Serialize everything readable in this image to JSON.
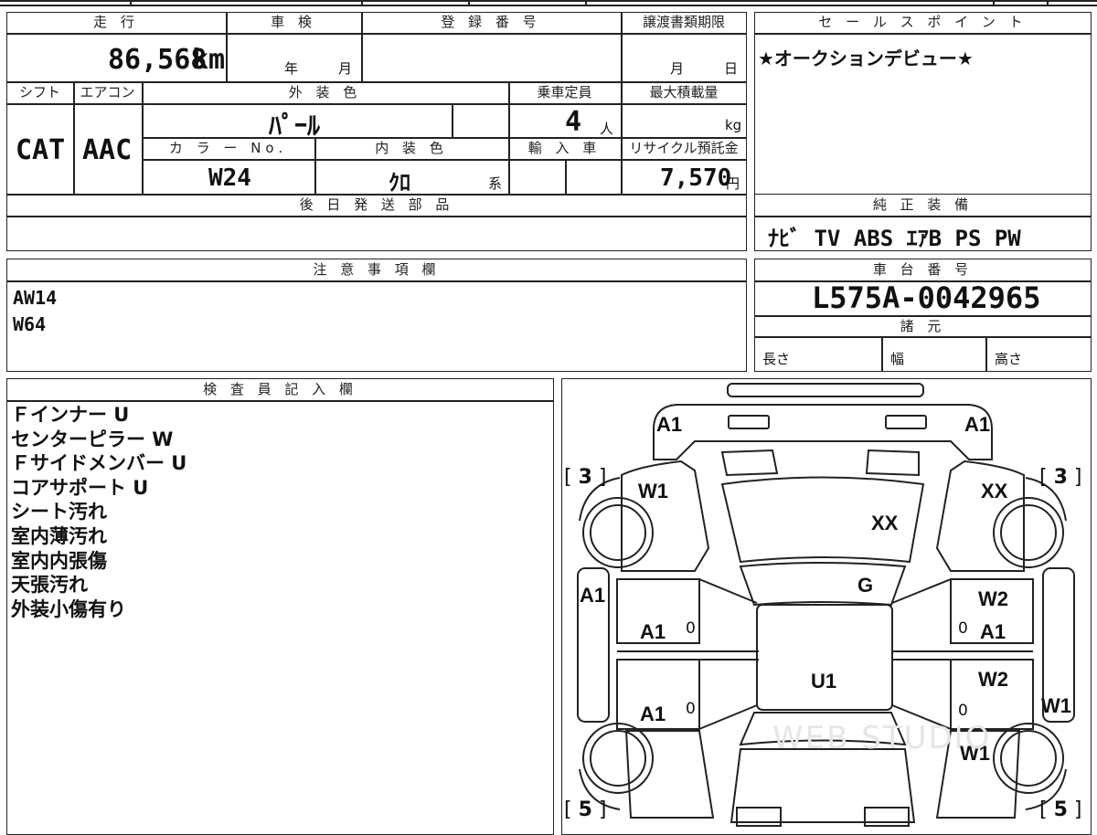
{
  "sheet": {
    "mileage": {
      "label": "走 行",
      "value": "86,568",
      "unit": "km"
    },
    "inspection": {
      "label": "車 検",
      "year_unit": "年",
      "month_unit": "月"
    },
    "registration": {
      "label": "登 録 番 号",
      "value": ""
    },
    "transfer_deadline": {
      "label": "譲渡書類期限",
      "month_unit": "月",
      "day_unit": "日"
    },
    "sales_points": {
      "label": "セ ー ル ス ポ イ ン ト",
      "value": "★オークションデビュー★"
    },
    "shift": {
      "label": "シフト",
      "value": "CAT"
    },
    "aircon": {
      "label": "エアコン",
      "value": "AAC"
    },
    "exterior_color": {
      "label": "外 装 色",
      "value": "ﾊﾟｰﾙ"
    },
    "capacity": {
      "label": "乗車定員",
      "value": "4",
      "unit": "人"
    },
    "max_load": {
      "label": "最大積載量",
      "value": "",
      "unit": "kg"
    },
    "color_no": {
      "label": "カ ラ ー No.",
      "value": "W24"
    },
    "interior_color": {
      "label": "内 装 色",
      "value": "ｸﾛ",
      "unit": "系"
    },
    "import": {
      "label": "輸 入 車",
      "value": ""
    },
    "recycle_fee": {
      "label": "リサイクル預託金",
      "value": "7,570",
      "unit": "円"
    },
    "later_parts": {
      "label": "後 日 発 送 部 品",
      "value": ""
    },
    "genuine_equipment": {
      "label": "純 正 装 備",
      "value": "ﾅﾋﾞ TV ABS ｴｱB PS PW"
    },
    "notes": {
      "label": "注 意 事 項 欄",
      "lines": [
        "AW14",
        "W64"
      ]
    },
    "chassis_number": {
      "label": "車 台 番 号",
      "value": "L575A-0042965"
    },
    "specs": {
      "label": "諸 元",
      "length": "長さ",
      "width": "幅",
      "height": "高さ"
    },
    "inspector": {
      "label": "検 査 員 記 入 欄",
      "lines": [
        "Ｆインナー U",
        "センターピラー W",
        "Ｆサイドメンバー U",
        "コアサポート U",
        "シート汚れ",
        "室内薄汚れ",
        "室内内張傷",
        "天張汚れ",
        "外装小傷有り"
      ]
    }
  },
  "diagram": {
    "marks": {
      "front_left_corner": "A1",
      "front_right_corner": "A1",
      "left_front_fender": "W1",
      "right_front_fender": "XX",
      "hood": "XX",
      "windshield": "G",
      "left_front_side": "A1",
      "right_front_door": "W2",
      "right_front_rocker": "A1",
      "roof": "U1",
      "left_rear_door": "A1",
      "right_rear_door": "W2",
      "right_rear_side": "W1",
      "right_rear_fender": "W1",
      "left_front_door_zero": "0",
      "left_rear_door_zero": "0",
      "right_front_door_zero": "0",
      "right_rear_door_zero": "0"
    },
    "tires": {
      "front_left": "3",
      "front_right": "3",
      "rear_left": "5",
      "rear_right": "5"
    },
    "watermark": "WEB STUDIO"
  }
}
